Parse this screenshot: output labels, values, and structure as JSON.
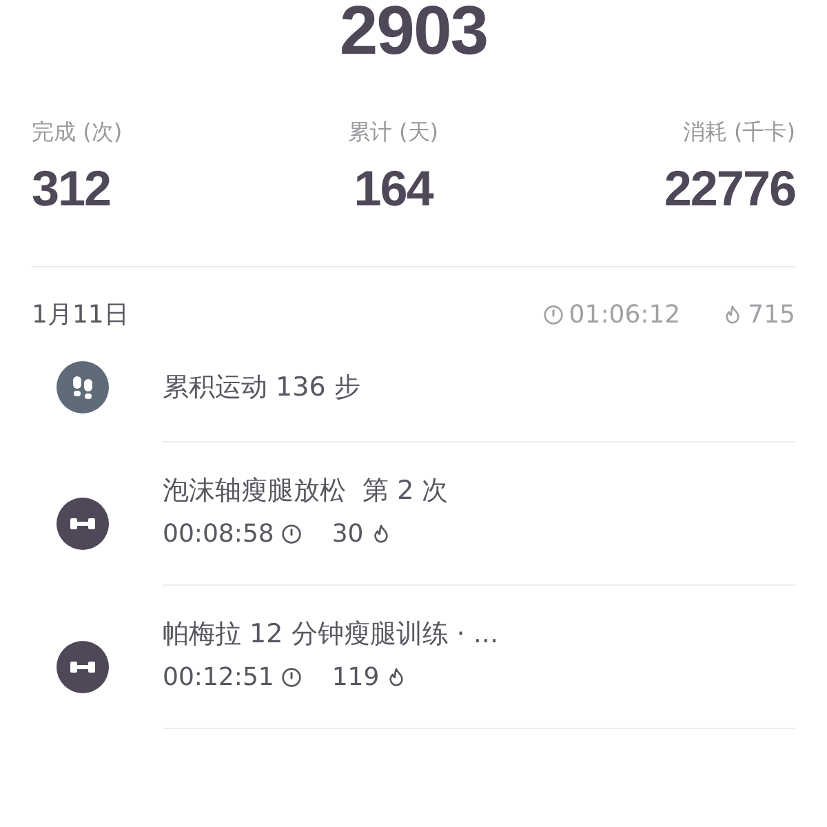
{
  "total": "2903",
  "stats": [
    {
      "label": "完成 (次)",
      "value": "312"
    },
    {
      "label": "累计 (天)",
      "value": "164"
    },
    {
      "label": "消耗 (千卡)",
      "value": "22776"
    }
  ],
  "day": {
    "date": "1月11日",
    "duration": "01:06:12",
    "calories": "715"
  },
  "entries": [
    {
      "kind": "steps",
      "title": "累积运动 136 步"
    },
    {
      "kind": "workout",
      "title": "泡沫轴瘦腿放松  第 2 次",
      "duration": "00:08:58",
      "calories": "30"
    },
    {
      "kind": "workout",
      "title": "帕梅拉 12 分钟瘦腿训练 · ...",
      "duration": "00:12:51",
      "calories": "119"
    }
  ]
}
